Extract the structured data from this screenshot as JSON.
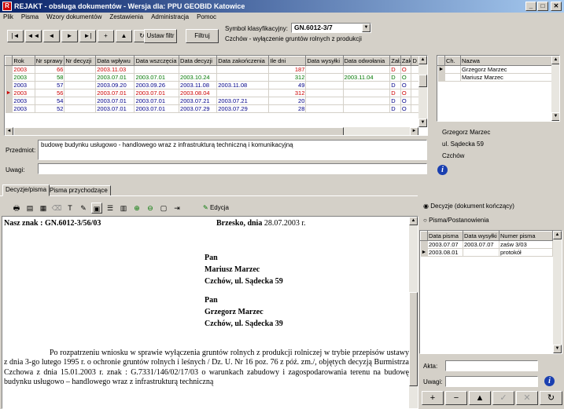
{
  "window": {
    "title": "REJAKT - obsługa dokumentów - Wersja dla: PPU GEOBID Katowice",
    "min": "_",
    "max": "□",
    "close": "✕"
  },
  "menu": [
    "Plik",
    "Pisma",
    "Wzory dokumentów",
    "Zestawienia",
    "Administracja",
    "Pomoc"
  ],
  "nav": {
    "first": "|◄",
    "prev_page": "◄◄",
    "prev": "◄",
    "next": "►",
    "last": "►|",
    "add": "+",
    "up": "▲",
    "refresh": "↻"
  },
  "filter": {
    "set_label": "Ustaw filtr",
    "filter_label": "Filtruj"
  },
  "symbol": {
    "label": "Symbol klasyfikacyjny:",
    "value": "GN.6012-3/7",
    "description": "Czchów - wyłączenie gruntów rolnych z produkcji"
  },
  "main_grid": {
    "columns": [
      "Rok",
      "Nr sprawy",
      "Nr decyzji",
      "Data wpływu",
      "Data wszczęcia",
      "Data decyzji",
      "Data zakończenia",
      "Ile dni",
      "Data wysyłki",
      "Data odwołania",
      "Zał.",
      "Zak.",
      "D"
    ],
    "rows": [
      {
        "c": "red",
        "v": [
          "2003",
          "66",
          "",
          "2003.11.03",
          "",
          "",
          "",
          "187",
          "",
          "",
          "D",
          "O",
          ""
        ]
      },
      {
        "c": "green",
        "v": [
          "2003",
          "58",
          "",
          "2003.07.01",
          "2003.07.01",
          "2003.10.24",
          "",
          "312",
          "",
          "2003.11.04",
          "D",
          "O",
          ""
        ]
      },
      {
        "c": "blue",
        "v": [
          "2003",
          "57",
          "",
          "2003.09.20",
          "2003.09.26",
          "2003.11.08",
          "2003.11.08",
          "49",
          "",
          "",
          "D",
          "O",
          ""
        ]
      },
      {
        "c": "red",
        "v": [
          "2003",
          "56",
          "",
          "2003.07.01",
          "2003.07.01",
          "2003.08.04",
          "",
          "312",
          "",
          "",
          "D",
          "O",
          ""
        ]
      },
      {
        "c": "blue",
        "v": [
          "2003",
          "54",
          "",
          "2003.07.01",
          "2003.07.01",
          "2003.07.21",
          "2003.07.21",
          "20",
          "",
          "",
          "D",
          "O",
          ""
        ]
      },
      {
        "c": "blue",
        "v": [
          "2003",
          "52",
          "",
          "2003.07.01",
          "2003.07.01",
          "2003.07.29",
          "2003.07.29",
          "28",
          "",
          "",
          "D",
          "O",
          ""
        ]
      }
    ],
    "current_row": 3
  },
  "subject": {
    "label": "Przedmiot:",
    "value": "budowę budynku usługowo - handlowego wraz z infrastrukturą techniczną  i komunikacyjną"
  },
  "remarks": {
    "label": "Uwagi:",
    "value": ""
  },
  "persons": {
    "columns": [
      "Ch.",
      "Nazwa"
    ],
    "rows": [
      "Grzegorz Marzec",
      "Mariusz Marzec"
    ],
    "detail_name": "Grzegorz Marzec",
    "detail_street": "ul. Sądecka 59",
    "detail_city": "Czchów"
  },
  "tabs": [
    "Decyzje/pisma",
    "Pisma przychodzące"
  ],
  "doc_toolbar": {
    "edit_label": "Edycja"
  },
  "document": {
    "ref": "Nasz znak : GN.6012-3/56/03",
    "place_date": "Brzesko, dnia ",
    "date": "28.07.2003 r.",
    "addr1": [
      "Pan",
      "Mariusz Marzec",
      "Czchów, ul. Sądecka 59"
    ],
    "addr2": [
      "Pan",
      "Grzegorz Marzec",
      "Czchów, ul. Sądecka 39"
    ],
    "body": "Po rozpatrzeniu wniosku w sprawie wyłączenia gruntów rolnych z produkcji rolniczej w trybie przepisów ustawy z dnia 3-go lutego 1995 r. o ochronie gruntów rolnych i leśnych   / Dz. U. Nr 16 poz. 76 z póź. zm./, objętych decyzją Burmistrza Czchowa z dnia 15.01.2003 r. znak : G.7331/146/02/17/03 o warunkach zabudowy i zagospodarowania terenu na budowę budynku usługowo – handlowego wraz z infrastrukturą techniczną"
  },
  "radio": {
    "opt1": "Decyzje (dokument kończący)",
    "opt2": "Pisma/Postanowienia"
  },
  "letters": {
    "columns": [
      "Data pisma",
      "Data wysyłki",
      "Numer pisma"
    ],
    "rows": [
      [
        "2003.07.07",
        "2003.07.07",
        "zaśw 3/03"
      ],
      [
        "2003.08.01",
        "",
        "protokół"
      ]
    ]
  },
  "akta": {
    "label": "Akta:",
    "value": ""
  },
  "uwagi2": {
    "label": "Uwagi:",
    "value": ""
  },
  "bottom_nav": {
    "add": "+",
    "del": "−",
    "up": "▲",
    "ok": "✓",
    "cancel": "✕",
    "refresh": "↻"
  }
}
